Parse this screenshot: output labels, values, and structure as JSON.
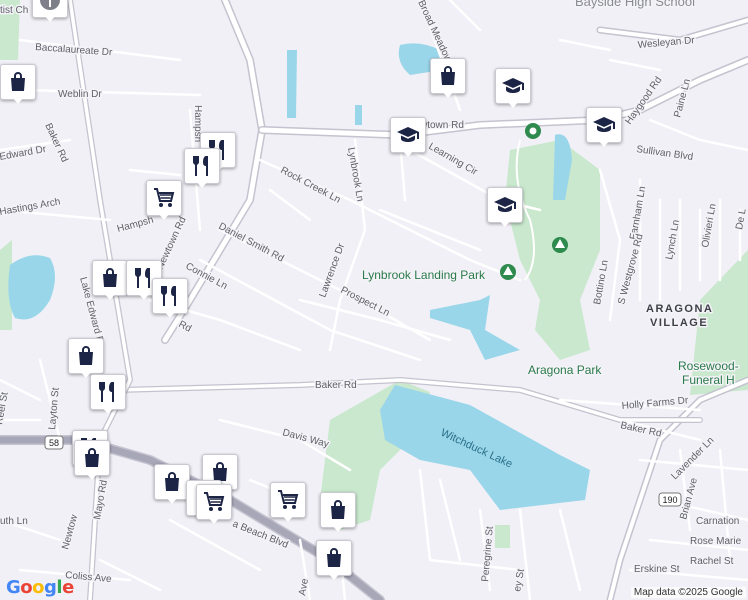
{
  "map": {
    "colors": {
      "background": "#f1f0f6",
      "water": "#9ad6ea",
      "park": "#c9e8cd",
      "major_road": "#c4c3cf",
      "street": "#ffffff",
      "marker_icon": "#1c2545"
    }
  },
  "labels": {
    "baptist": "tist Ch",
    "baccalaureate": "Baccalaureate Dr",
    "weblin": "Weblin Dr",
    "baker_rd_w": "Baker Rd",
    "edward": "Edward Dr",
    "hastings": "Hastings Arch",
    "hampshire_n": "Hampsh",
    "hampshire_s": "Hampsh",
    "rock_creek": "Rock Creek Ln",
    "lynbrook_ln": "Lynbrook Ln",
    "daniel_smith": "Daniel Smith Rd",
    "newtown_w": "Newtown Rd",
    "connie": "Connie Ln",
    "rd_suffix": "Rd",
    "lawrence": "Lawrence Dr",
    "prospect": "Prospect Ln",
    "lake_edward": "Lake Edward Dr",
    "reel": "Reel St",
    "layton": "Layton St",
    "baker_rd_c": "Baker Rd",
    "davis_way": "Davis Way",
    "route_58": "58",
    "newtown_sw": "Newtow",
    "mayo": "Mayo Rd",
    "beach_blvd": "a Beach Blvd",
    "coliss": "Coliss Ave",
    "ave": "Ave",
    "uth_ln": "uth Ln",
    "broad_meadows": "Broad Meadows",
    "bayside_hs": "Bayside High School",
    "wesleyan": "Wesleyan Dr",
    "newtown_rd_n": "wtown Rd",
    "learning_cir": "Learning Cir",
    "haygood": "Haygood Rd",
    "paine": "Paine Ln",
    "sullivan": "Sullivan Blvd",
    "lynbrook_park": "Lynbrook Landing Park",
    "farnham": "Farnham Ln",
    "westgrove": "S Westgrove Rd",
    "lynch": "Lynch Ln",
    "olivieri": "Olivieri Ln",
    "de_l": "De L",
    "bottino": "Bottino Ln",
    "aragona_village_1": "ARAGONA",
    "aragona_village_2": "VILLAGE",
    "aragona_park": "Aragona Park",
    "rosewood_1": "Rosewood-",
    "rosewood_2": "Funeral H",
    "holly_farms": "Holly Farms Dr",
    "baker_rd_e": "Baker Rd",
    "witchduck_lake": "Witchduck Lake",
    "route_190": "190",
    "lavender": "Lavender Ln",
    "brian": "Brian Ave",
    "carnation": "Carnation",
    "rose_marie": "Rose Marie",
    "rachel": "Rachel St",
    "erskine": "Erskine St",
    "peregrine": "Peregrine St",
    "ey_st": "ey St"
  },
  "markers": [
    {
      "icon": "church-icon"
    },
    {
      "icon": "shopping-bag-icon"
    },
    {
      "icon": "shopping-bag-icon"
    },
    {
      "icon": "school-icon"
    },
    {
      "icon": "school-icon"
    },
    {
      "icon": "school-icon"
    },
    {
      "icon": "school-icon"
    },
    {
      "icon": "restaurant-icon"
    },
    {
      "icon": "restaurant-icon"
    },
    {
      "icon": "shopping-cart-icon"
    },
    {
      "icon": "shopping-bag-icon"
    },
    {
      "icon": "restaurant-icon"
    },
    {
      "icon": "restaurant-icon"
    },
    {
      "icon": "shopping-bag-icon"
    },
    {
      "icon": "restaurant-icon"
    },
    {
      "icon": "restaurant-icon"
    },
    {
      "icon": "shopping-bag-icon"
    },
    {
      "icon": "shopping-bag-icon"
    },
    {
      "icon": "shopping-bag-icon"
    },
    {
      "icon": "shopping-bag-icon"
    },
    {
      "icon": "shopping-cart-icon"
    },
    {
      "icon": "shopping-cart-icon"
    },
    {
      "icon": "shopping-bag-icon"
    },
    {
      "icon": "shopping-bag-icon"
    }
  ],
  "footer": {
    "logo": "Google",
    "attribution": "Map data ©2025 Google"
  }
}
